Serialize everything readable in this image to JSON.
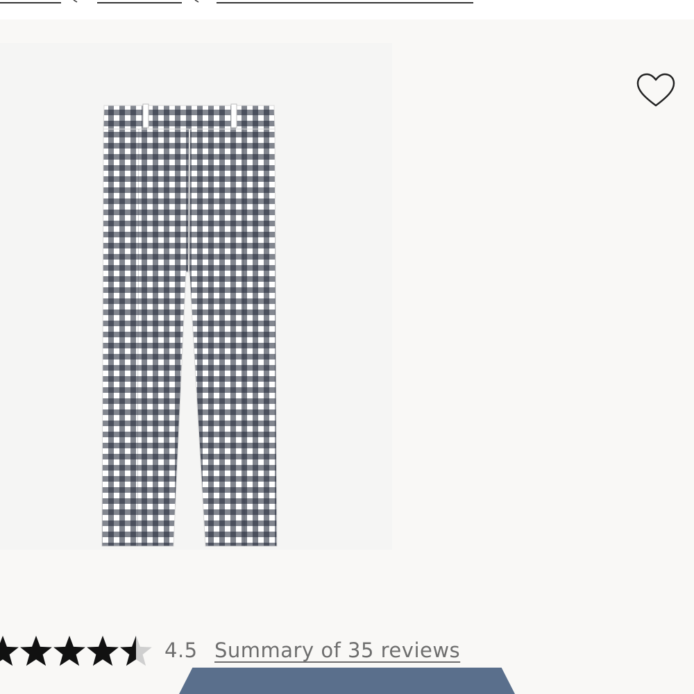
{
  "product": {
    "image_alt": "Gingham cropped pants",
    "colors": {
      "fabric_dark": "#1c2233",
      "fabric_light": "#ffffff"
    }
  },
  "favorite": {
    "icon": "heart-outline-icon"
  },
  "rating": {
    "value": "4.5",
    "stars_filled": 4.5,
    "stars_total": 5,
    "reviews_link": "Summary of 35 reviews"
  },
  "colors": {
    "background": "#f9f8f6",
    "image_background": "#f5f5f4",
    "star": "#111111",
    "star_empty": "#cfcfcf",
    "text_muted": "#6e6e6e",
    "cta": "#5a6f8c"
  }
}
